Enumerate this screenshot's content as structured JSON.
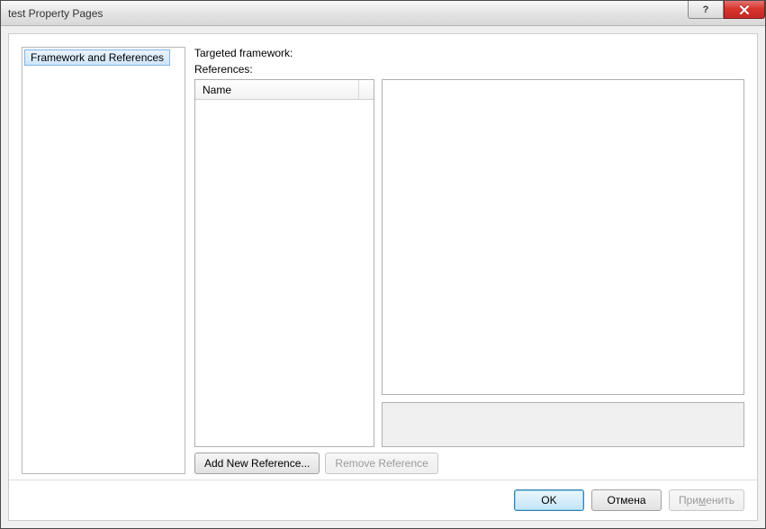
{
  "window": {
    "title": "test Property Pages",
    "help_tooltip": "?",
    "close_tooltip": "Close"
  },
  "tree": {
    "item_framework_refs": "Framework and References"
  },
  "labels": {
    "targeted_framework": "Targeted framework:",
    "references": "References:",
    "column_name": "Name"
  },
  "buttons": {
    "add_new_reference": "Add New Reference...",
    "remove_reference": "Remove Reference",
    "ok": "OK",
    "cancel": "Отмена",
    "apply_prefix": "При",
    "apply_u": "м",
    "apply_suffix": "енить"
  }
}
